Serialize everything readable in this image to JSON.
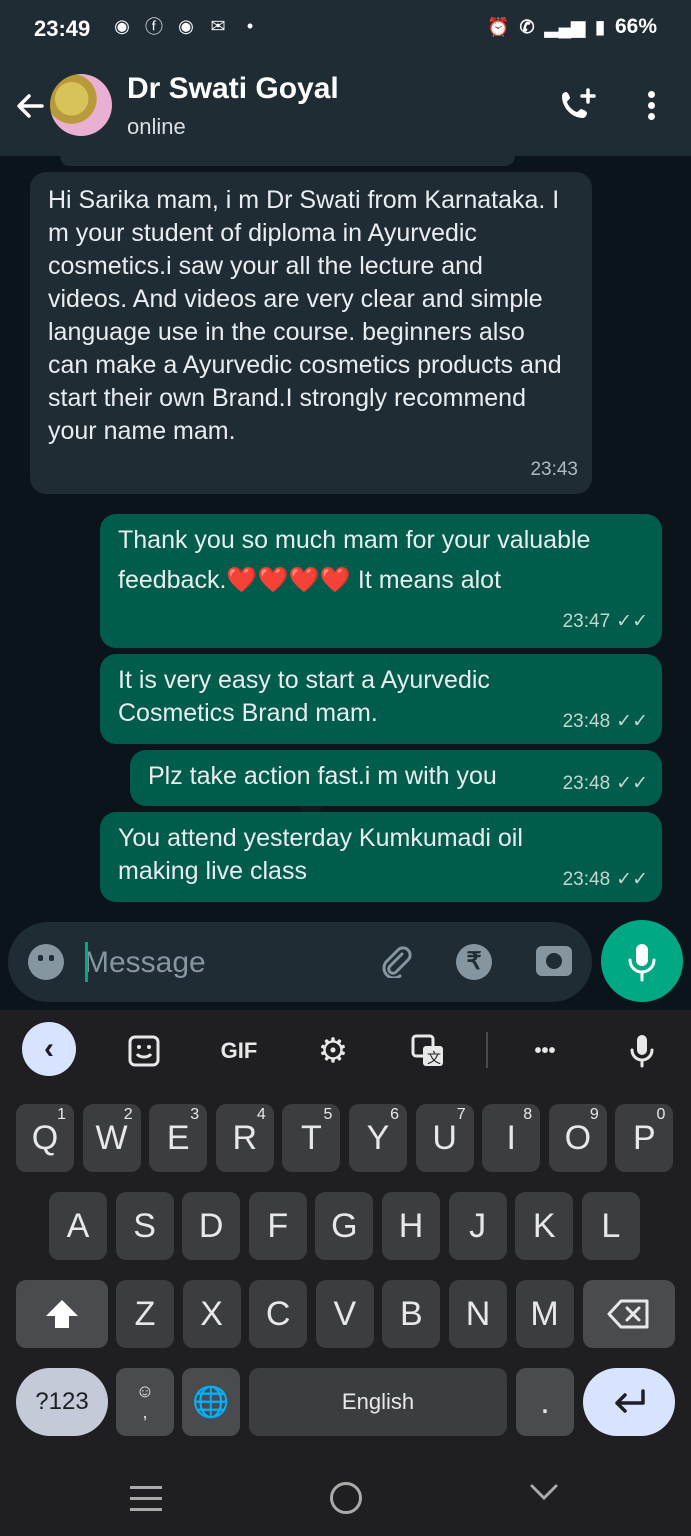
{
  "status_bar": {
    "time": "23:49",
    "battery": "66%"
  },
  "chat_header": {
    "name": "Dr Swati Goyal",
    "status": "online"
  },
  "messages": [
    {
      "direction": "incoming",
      "text": "Hi Sarika mam, i m Dr Swati  from Karnataka. I m your student of diploma in Ayurvedic cosmetics.i saw your all the lecture and videos. And videos are very clear and simple language use in the course. beginners also can make a Ayurvedic cosmetics products and start their own Brand.I strongly recommend your name mam.",
      "time": "23:43"
    },
    {
      "direction": "outgoing",
      "text_a": "Thank you so much mam for your valuable feedback.",
      "emojis": "❤️❤️❤️❤️",
      "text_b": " It means alot",
      "time": "23:47",
      "ticks": "✓✓"
    },
    {
      "direction": "outgoing",
      "text": "It is very easy to start a Ayurvedic Cosmetics Brand mam.",
      "time": "23:48",
      "ticks": "✓✓"
    },
    {
      "direction": "outgoing",
      "text": "Plz take action fast.i m with you",
      "time": "23:48",
      "ticks": "✓✓"
    },
    {
      "direction": "outgoing",
      "text": "You attend yesterday Kumkumadi oil making live class",
      "time": "23:48",
      "ticks": "✓✓"
    }
  ],
  "composer": {
    "placeholder": "Message"
  },
  "keyboard": {
    "toolbar": {
      "gif": "GIF",
      "more": "•••"
    },
    "row1": [
      {
        "k": "Q",
        "n": "1"
      },
      {
        "k": "W",
        "n": "2"
      },
      {
        "k": "E",
        "n": "3"
      },
      {
        "k": "R",
        "n": "4"
      },
      {
        "k": "T",
        "n": "5"
      },
      {
        "k": "Y",
        "n": "6"
      },
      {
        "k": "U",
        "n": "7"
      },
      {
        "k": "I",
        "n": "8"
      },
      {
        "k": "O",
        "n": "9"
      },
      {
        "k": "P",
        "n": "0"
      }
    ],
    "row2": [
      "A",
      "S",
      "D",
      "F",
      "G",
      "H",
      "J",
      "K",
      "L"
    ],
    "row3": [
      "Z",
      "X",
      "C",
      "V",
      "B",
      "N",
      "M"
    ],
    "symbols": "?123",
    "comma": ",",
    "space": "English",
    "period": "."
  },
  "colors": {
    "outgoing_bubble": "#005c4b",
    "incoming_bubble": "#1f2c34",
    "accent": "#00a884"
  }
}
